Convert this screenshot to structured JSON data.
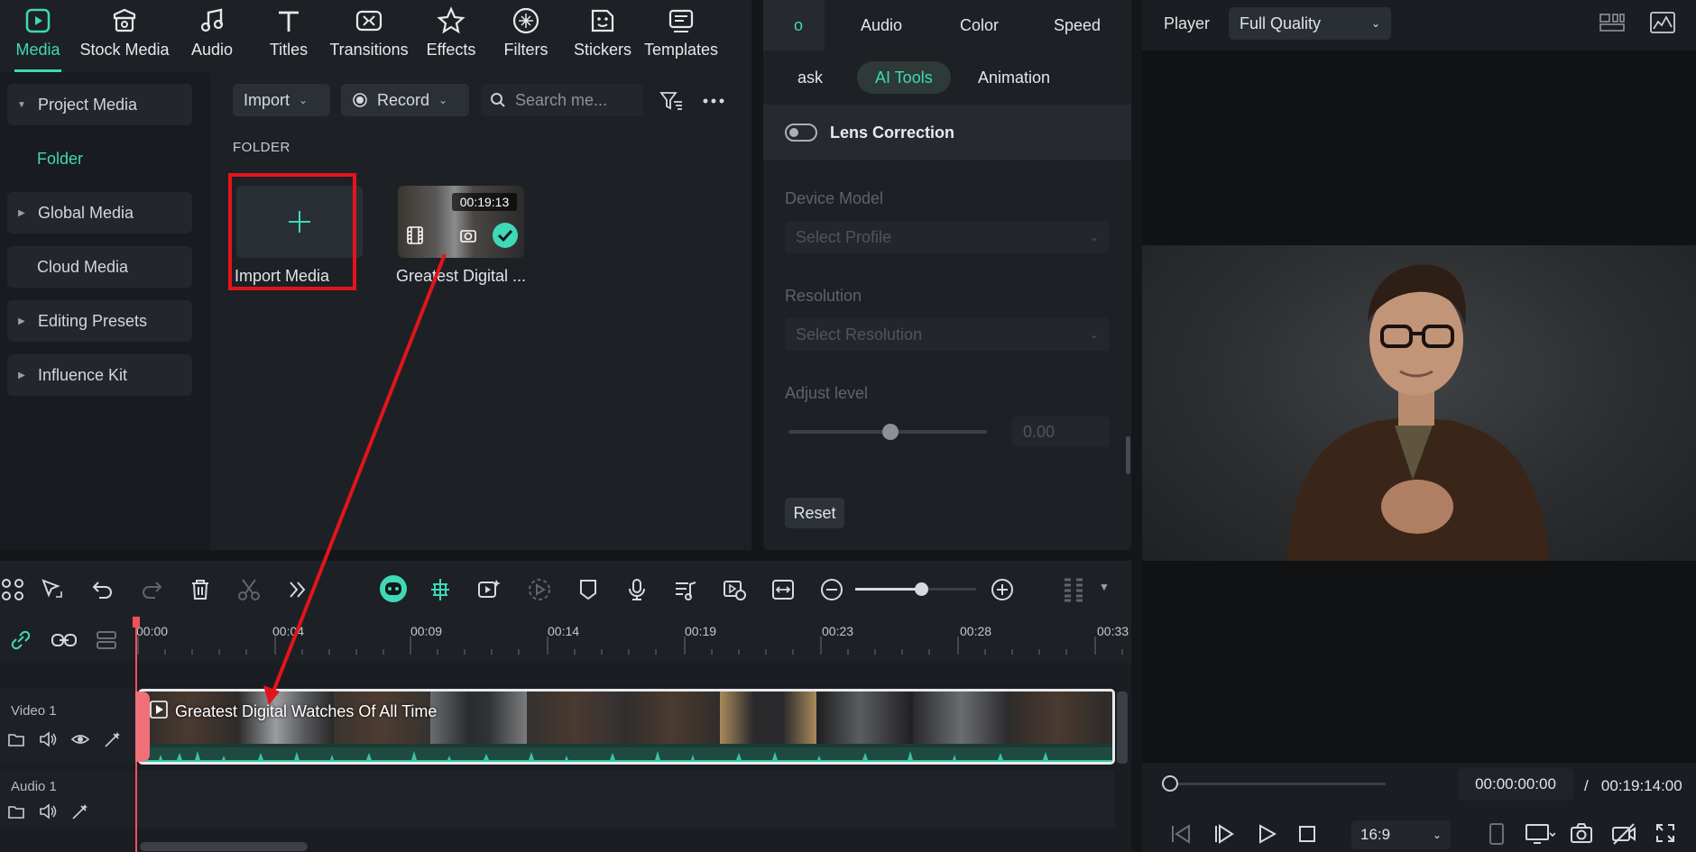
{
  "media_tabs": [
    {
      "label": "Media",
      "icon": "media-icon",
      "active": true
    },
    {
      "label": "Stock Media",
      "icon": "stock-media-icon"
    },
    {
      "label": "Audio",
      "icon": "music-note-icon"
    },
    {
      "label": "Titles",
      "icon": "titles-icon"
    },
    {
      "label": "Transitions",
      "icon": "transitions-icon"
    },
    {
      "label": "Effects",
      "icon": "effects-icon"
    },
    {
      "label": "Filters",
      "icon": "filters-icon"
    },
    {
      "label": "Stickers",
      "icon": "stickers-icon"
    },
    {
      "label": "Templates",
      "icon": "templates-icon"
    }
  ],
  "sidebar": {
    "items": [
      {
        "label": "Project Media",
        "caret": "▼"
      },
      {
        "label": "Folder"
      },
      {
        "label": "Global Media",
        "caret": "▶"
      },
      {
        "label": "Cloud Media"
      },
      {
        "label": "Editing Presets",
        "caret": "▶"
      },
      {
        "label": "Influence Kit",
        "caret": "▶"
      }
    ]
  },
  "media": {
    "import_label": "Import",
    "record_label": "Record",
    "search_placeholder": "Search me...",
    "folder_label": "FOLDER",
    "import_media_label": "Import Media",
    "clip_name": "Greatest Digital ...",
    "clip_duration": "00:19:13"
  },
  "properties": {
    "tabs": [
      "o",
      "Audio",
      "Color",
      "Speed"
    ],
    "sub_tabs": [
      "ask",
      "AI Tools",
      "Animation"
    ],
    "lens_correction": "Lens Correction",
    "device_model_label": "Device Model",
    "device_model_placeholder": "Select Profile",
    "resolution_label": "Resolution",
    "resolution_placeholder": "Select Resolution",
    "adjust_level_label": "Adjust level",
    "adjust_level_value": "0.00",
    "reset_label": "Reset"
  },
  "player": {
    "label": "Player",
    "quality": "Full Quality",
    "current_time": "00:00:00:00",
    "separator": "/",
    "total_time": "00:19:14:00",
    "aspect_ratio": "16:9"
  },
  "timeline": {
    "ticks": [
      "00:00",
      "00:04",
      "00:09",
      "00:14",
      "00:19",
      "00:23",
      "00:28",
      "00:33"
    ],
    "video_track": "Video 1",
    "audio_track": "Audio 1",
    "clip_title": "Greatest Digital Watches Of All Time"
  },
  "colors": {
    "accent": "#3fd9b6",
    "highlight_box": "#e3141b",
    "playhead": "#f0505a"
  }
}
